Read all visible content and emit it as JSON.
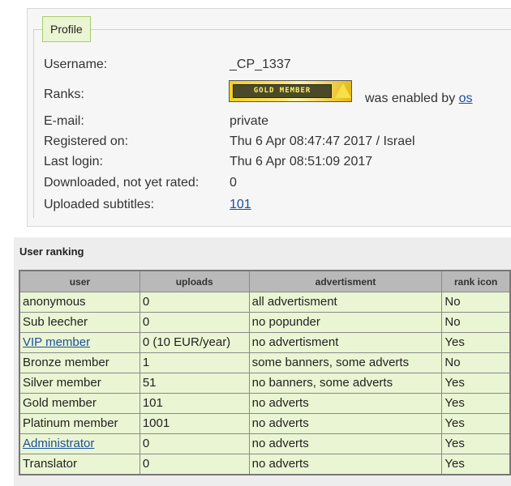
{
  "profile": {
    "legend": "Profile",
    "username_label": "Username:",
    "username_value": "_CP_1337",
    "ranks_label": "Ranks:",
    "rank_badge_text": "GOLD MEMBER",
    "rank_enabled_text": "was enabled by",
    "rank_enabled_by": "os",
    "email_label": "E-mail:",
    "email_value": "private",
    "registered_label": "Registered on:",
    "registered_value": "Thu 6 Apr 08:47:47 2017 / Israel",
    "last_login_label": "Last login:",
    "last_login_value": "Thu 6 Apr 08:51:09 2017",
    "downloaded_label": "Downloaded, not yet rated:",
    "downloaded_value": "0",
    "uploaded_label": "Uploaded subtitles:",
    "uploaded_value": "101"
  },
  "ranking": {
    "title": "User ranking",
    "headers": [
      "user",
      "uploads",
      "advertisment",
      "rank icon"
    ],
    "rows": [
      {
        "user": "anonymous",
        "uploads": "0",
        "ads": "all advertisment",
        "icon": "No",
        "link": false
      },
      {
        "user": "Sub leecher",
        "uploads": "0",
        "ads": "no popunder",
        "icon": "No",
        "link": false
      },
      {
        "user": "VIP member",
        "uploads": "0 (10 EUR/year)",
        "ads": "no advertisment",
        "icon": "Yes",
        "link": true
      },
      {
        "user": "Bronze member",
        "uploads": "1",
        "ads": "some banners, some adverts",
        "icon": "No",
        "link": false
      },
      {
        "user": "Silver member",
        "uploads": "51",
        "ads": "no banners, some adverts",
        "icon": "Yes",
        "link": false
      },
      {
        "user": "Gold member",
        "uploads": "101",
        "ads": "no adverts",
        "icon": "Yes",
        "link": false
      },
      {
        "user": "Platinum member",
        "uploads": "1001",
        "ads": "no adverts",
        "icon": "Yes",
        "link": false
      },
      {
        "user": "Administrator",
        "uploads": "0",
        "ads": "no adverts",
        "icon": "Yes",
        "link": true
      },
      {
        "user": "Translator",
        "uploads": "0",
        "ads": "no adverts",
        "icon": "Yes",
        "link": false
      }
    ]
  },
  "colors": {
    "row_bg": "#eaf5d3",
    "header_bg": "#b9b9b9",
    "link": "#1a4f9c",
    "badge_gold": "#f3cf1a"
  }
}
